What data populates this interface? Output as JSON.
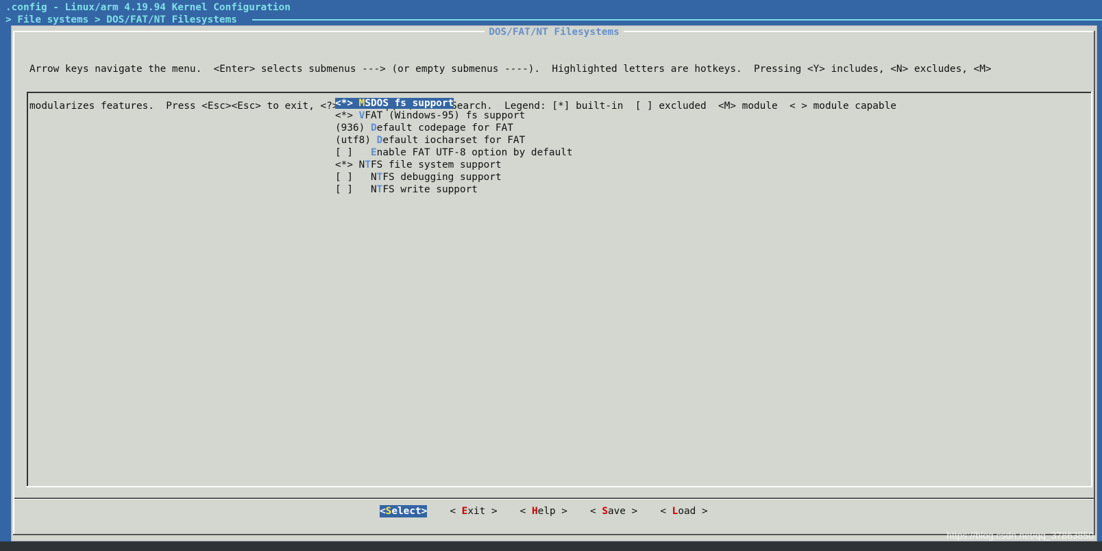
{
  "header": {
    "title": ".config - Linux/arm 4.19.94 Kernel Configuration",
    "breadcrumb": "> File systems > DOS/FAT/NT Filesystems"
  },
  "dialog": {
    "title": "DOS/FAT/NT Filesystems",
    "help_line_1": "Arrow keys navigate the menu.  <Enter> selects submenus ---> (or empty submenus ----).  Highlighted letters are hotkeys.  Pressing <Y> includes, <N> excludes, <M>",
    "help_line_2": "modularizes features.  Press <Esc><Esc> to exit, <?> for Help, </> for Search.  Legend: [*] built-in  [ ] excluded  <M> module  < > module capable"
  },
  "menu": {
    "items": [
      {
        "prefix": "<*> ",
        "hotkey": "M",
        "rest": "SDOS fs support",
        "selected": true
      },
      {
        "prefix": "<*> ",
        "hotkey": "V",
        "rest": "FAT (Windows-95) fs support"
      },
      {
        "prefix": "(936) ",
        "hotkey": "D",
        "rest": "efault codepage for FAT"
      },
      {
        "prefix": "(utf8) ",
        "hotkey": "D",
        "rest": "efault iocharset for FAT"
      },
      {
        "prefix": "[ ]   ",
        "hotkey": "E",
        "rest": "nable FAT UTF-8 option by default"
      },
      {
        "prefix": "<*> N",
        "hotkey": "T",
        "rest": "FS file system support"
      },
      {
        "prefix": "[ ]   N",
        "hotkey": "T",
        "rest": "FS debugging support"
      },
      {
        "prefix": "[ ]   N",
        "hotkey": "T",
        "rest": "FS write support"
      }
    ]
  },
  "buttons": {
    "select": {
      "open": "<",
      "key": "S",
      "rest": "elect>"
    },
    "exit": {
      "open": "< ",
      "key": "E",
      "rest": "xit >"
    },
    "help": {
      "open": "< ",
      "key": "H",
      "rest": "elp >"
    },
    "save": {
      "open": "< ",
      "key": "S",
      "rest": "ave >"
    },
    "load": {
      "open": "< ",
      "key": "L",
      "rest": "oad >"
    }
  },
  "watermark": "https://blog.csdn.net/qq_37863850"
}
